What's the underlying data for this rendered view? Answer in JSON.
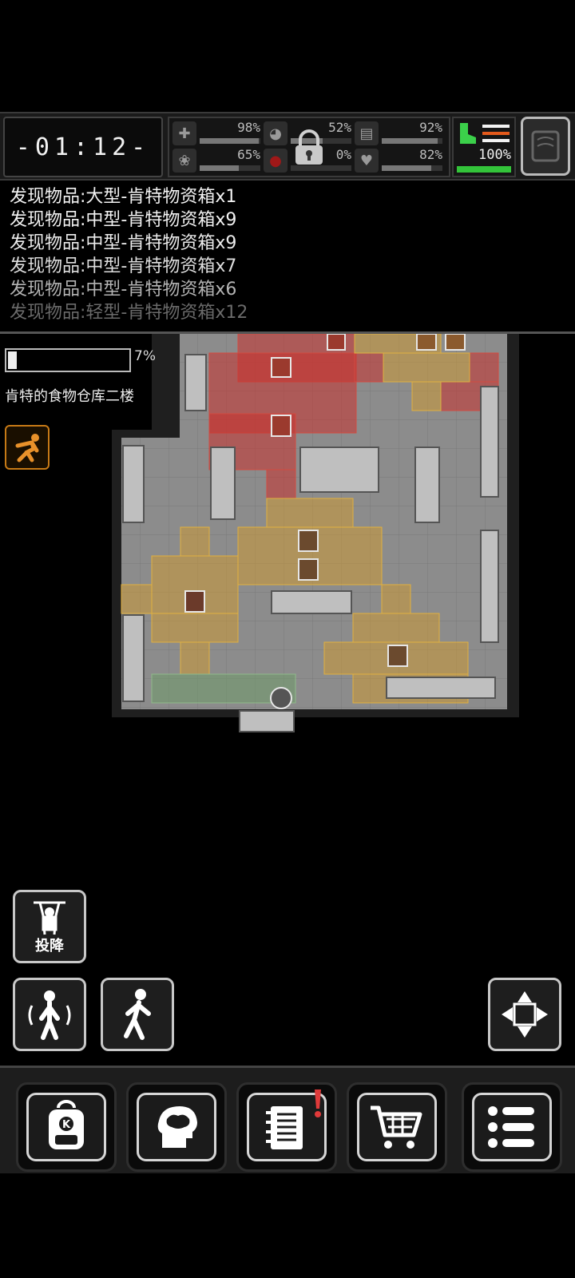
{
  "hud": {
    "clock": "-01:12-",
    "stats": [
      {
        "icon": "medkit-icon",
        "pct": "98%",
        "level": 0.98
      },
      {
        "icon": "stomach-icon",
        "pct": "52%",
        "level": 0.52
      },
      {
        "icon": "water-icon",
        "pct": "92%",
        "level": 0.92
      },
      {
        "icon": "brain-icon",
        "pct": "65%",
        "level": 0.65
      },
      {
        "icon": "blood-drop-icon",
        "pct": "0%",
        "level": 0.0
      },
      {
        "icon": "heart-icon",
        "pct": "82%",
        "level": 0.82
      }
    ],
    "stamina_pct": "100%",
    "stamina_level": 1.0,
    "accent_green": "#33c43a"
  },
  "log": [
    {
      "text": "发现物品:大型-肯特物资箱x1",
      "color": "#f2f2f2"
    },
    {
      "text": "发现物品:中型-肯特物资箱x9",
      "color": "#f2f2f2"
    },
    {
      "text": "发现物品:中型-肯特物资箱x9",
      "color": "#ececec"
    },
    {
      "text": "发现物品:中型-肯特物资箱x7",
      "color": "#dedede"
    },
    {
      "text": "发现物品:中型-肯特物资箱x6",
      "color": "#b4b4b4"
    },
    {
      "text": "发现物品:轻型-肯特物资箱x12",
      "color": "#6a6a6a"
    }
  ],
  "search": {
    "progress_pct": "7%",
    "progress_level": 0.07,
    "location": "肯特的食物仓库二楼"
  },
  "actions": {
    "surrender_label": "投降"
  },
  "nav": [
    {
      "name": "backpack-button",
      "icon": "backpack-icon"
    },
    {
      "name": "skills-button",
      "icon": "brain-head-icon"
    },
    {
      "name": "journal-button",
      "icon": "notebook-icon"
    },
    {
      "name": "shop-button",
      "icon": "cart-icon"
    },
    {
      "name": "menu-button",
      "icon": "menu-list-icon"
    }
  ],
  "colors": {
    "danger_zone": "#c8322e",
    "alert_zone": "#d29a2c",
    "safe_zone": "#6f9a6a",
    "sneak_accent": "#c77a16"
  }
}
